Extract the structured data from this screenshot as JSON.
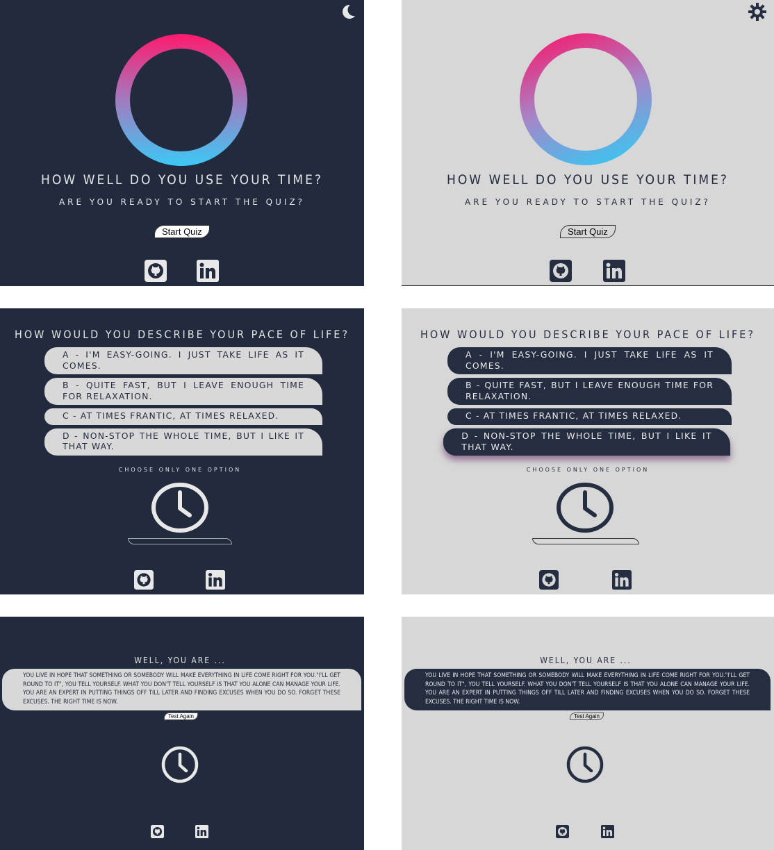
{
  "start": {
    "title": "HOW WELL DO YOU USE YOUR TIME?",
    "subtitle": "ARE YOU READY TO START THE QUIZ?",
    "start_button": "Start Quiz"
  },
  "question": {
    "title": "HOW WOULD YOU DESCRIBE YOUR PACE OF LIFE?",
    "options": [
      "A - I'M EASY-GOING. I JUST TAKE LIFE AS IT COMES.",
      "B - QUITE FAST, BUT I LEAVE ENOUGH TIME FOR RELAXATION.",
      "C - AT TIMES FRANTIC, AT TIMES RELAXED.",
      "D - NON-STOP THE WHOLE TIME, BUT I LIKE IT THAT WAY."
    ],
    "hint": "CHOOSE ONLY ONE OPTION",
    "progress": 0
  },
  "result": {
    "title": "WELL, YOU ARE ...",
    "text": "YOU LIVE IN HOPE THAT SOMETHING OR SOMEBODY WILL MAKE EVERYTHING IN LIFE COME RIGHT FOR YOU.\"I'LL GET ROUND TO IT\", YOU TELL YOURSELF. WHAT YOU DON'T TELL YOURSELF IS THAT YOU ALONE CAN MANAGE YOUR LIFE. YOU ARE AN EXPERT IN PUTTING THINGS OFF TILL LATER AND FINDING EXCUSES WHEN YOU DO SO. FORGET THESE EXCUSES. THE RIGHT TIME IS NOW.",
    "again_button": "Test Again"
  },
  "icons": {
    "dark_theme_toggle": "moon-icon",
    "light_theme_toggle": "sun-icon",
    "social": [
      "github-icon",
      "linkedin-icon"
    ],
    "timer": "clock-icon"
  },
  "colors": {
    "dark_bg": "#222b3e",
    "light_bg": "#d7d7d7",
    "ring_pink": "#ff1a6d",
    "ring_blue": "#3cc9f5"
  }
}
